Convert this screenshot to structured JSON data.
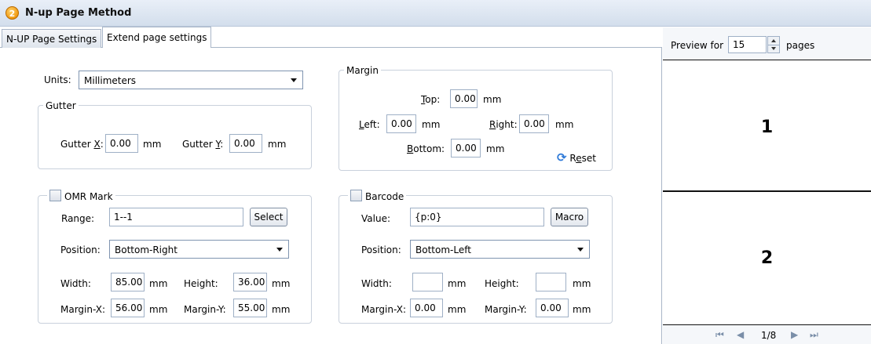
{
  "window": {
    "title": "N-up Page Method",
    "badge": "2"
  },
  "tabs": [
    {
      "label": "N-UP Page Settings",
      "active": false
    },
    {
      "label": "Extend page settings",
      "active": true
    }
  ],
  "units": {
    "label": "Units:",
    "value": "Millimeters"
  },
  "gutter": {
    "title": "Gutter",
    "x_label_pre": "Gutter ",
    "x_label_key": "X",
    "x_label_post": ":",
    "x_value": "0.00",
    "x_unit": "mm",
    "y_label_pre": "Gutter ",
    "y_label_key": "Y",
    "y_label_post": ":",
    "y_value": "0.00",
    "y_unit": "mm"
  },
  "margin": {
    "title": "Margin",
    "top_key": "T",
    "top_rest": "op:",
    "top_value": "0.00",
    "top_unit": "mm",
    "left_key": "L",
    "left_rest": "eft:",
    "left_value": "0.00",
    "left_unit": "mm",
    "right_key": "R",
    "right_rest": "ight:",
    "right_value": "0.00",
    "right_unit": "mm",
    "bottom_key": "B",
    "bottom_rest": "ottom:",
    "bottom_value": "0.00",
    "bottom_unit": "mm",
    "reset_pre": "R",
    "reset_key": "e",
    "reset_post": "set",
    "reset_icon": "refresh-icon"
  },
  "omr": {
    "title": "OMR Mark",
    "checked": false,
    "range_label": "Range:",
    "range_value": "1--1",
    "select_label": "Select",
    "position_label": "Position:",
    "position_value": "Bottom-Right",
    "width_label": "Width:",
    "width_value": "85.00",
    "width_unit": "mm",
    "height_label": "Height:",
    "height_value": "36.00",
    "height_unit": "mm",
    "mx_label": "Margin-X:",
    "mx_value": "56.00",
    "mx_unit": "mm",
    "my_label": "Margin-Y:",
    "my_value": "55.00",
    "my_unit": "mm"
  },
  "barcode": {
    "title": "Barcode",
    "checked": false,
    "value_label": "Value:",
    "value_value": "{p:0}",
    "macro_label": "Macro",
    "position_label": "Position:",
    "position_value": "Bottom-Left",
    "width_label": "Width:",
    "width_value": "",
    "width_unit": "mm",
    "height_label": "Height:",
    "height_value": "",
    "height_unit": "mm",
    "mx_label": "Margin-X:",
    "mx_value": "0.00",
    "mx_unit": "mm",
    "my_label": "Margin-Y:",
    "my_value": "0.00",
    "my_unit": "mm"
  },
  "preview": {
    "label_pre": "Preview for",
    "count": "15",
    "label_post": "pages",
    "pages": [
      "1",
      "2"
    ],
    "page_indicator": "1/8",
    "nav": {
      "first": "⏮",
      "prev": "◀",
      "next": "▶",
      "last": "⏭"
    }
  },
  "colors": {
    "title_bg": "#d3deec",
    "border": "#a9b6c8",
    "accent": "#2f7ad8"
  }
}
